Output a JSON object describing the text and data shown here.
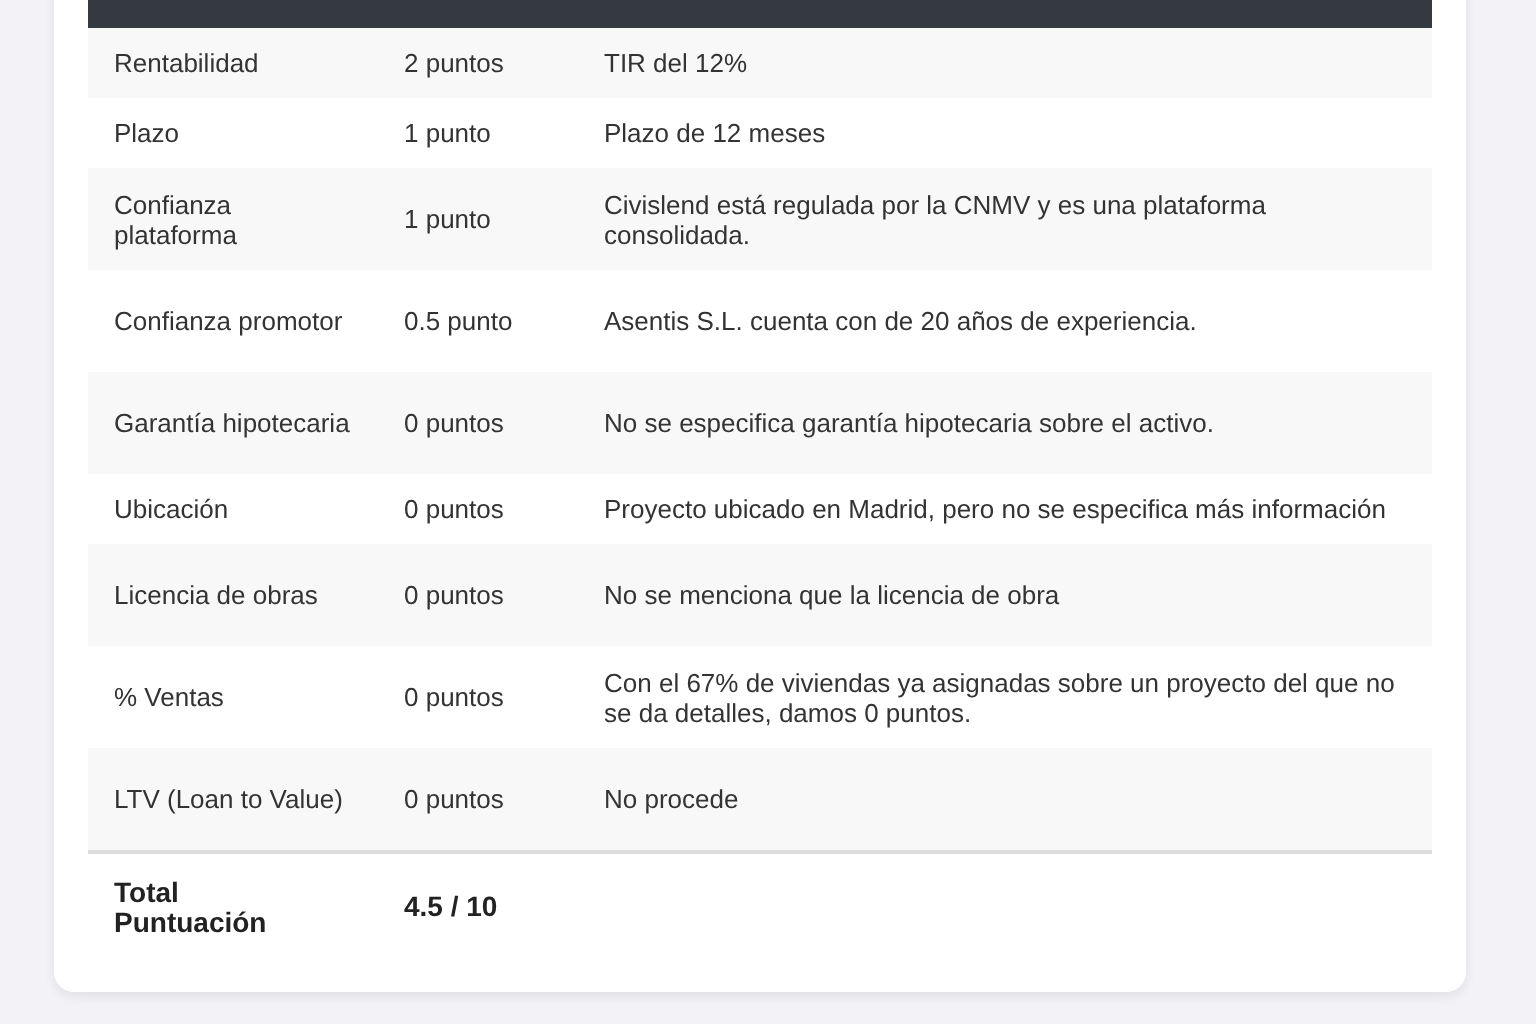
{
  "table": {
    "rows": [
      {
        "criterion": "Rentabilidad",
        "score": "2 puntos",
        "detail": "TIR del 12%"
      },
      {
        "criterion": "Plazo",
        "score": "1 punto",
        "detail": "Plazo de 12 meses"
      },
      {
        "criterion": "Confianza plataforma",
        "score": "1 punto",
        "detail": "Civislend está regulada por la CNMV y es una plataforma consolidada."
      },
      {
        "criterion": "Confianza promotor",
        "score": "0.5 punto",
        "detail": "Asentis S.L. cuenta con de 20 años de experiencia."
      },
      {
        "criterion": "Garantía hipotecaria",
        "score": "0 puntos",
        "detail": "No se especifica garantía hipotecaria sobre el activo."
      },
      {
        "criterion": "Ubicación",
        "score": "0 puntos",
        "detail": "Proyecto ubicado en Madrid, pero no se especifica más información"
      },
      {
        "criterion": "Licencia de obras",
        "score": "0 puntos",
        "detail": "No se menciona que la licencia de obra"
      },
      {
        "criterion": "% Ventas",
        "score": "0 puntos",
        "detail": "Con el 67% de viviendas ya asignadas sobre un proyecto del que no se da detalles, damos 0 puntos."
      },
      {
        "criterion": "LTV (Loan to Value)",
        "score": "0 puntos",
        "detail": "No procede"
      }
    ],
    "total": {
      "label": "Total Puntuación",
      "score": "4.5 / 10"
    }
  }
}
